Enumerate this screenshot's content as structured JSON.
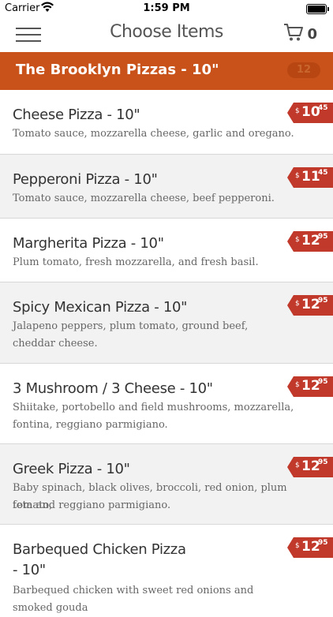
{
  "status_bar": {
    "carrier": "Carrier",
    "time": "1:59 PM"
  },
  "nav": {
    "title": "Choose Items",
    "cart_count": "0"
  },
  "section": {
    "title": "The Brooklyn Pizzas - 10\"",
    "count": "12"
  },
  "items": [
    {
      "name": "Cheese Pizza - 10\"",
      "desc_lines": [
        "Tomato sauce, mozzarella cheese, garlic and oregano."
      ],
      "price": {
        "currency": "$",
        "whole": "10",
        "cents": "45"
      }
    },
    {
      "name": "Pepperoni Pizza - 10\"",
      "desc_lines": [
        "Tomato sauce, mozzarella cheese, beef pepperoni."
      ],
      "price": {
        "currency": "$",
        "whole": "11",
        "cents": "45"
      }
    },
    {
      "name": "Margherita Pizza - 10\"",
      "desc_lines": [
        "Plum tomato, fresh mozzarella, and fresh basil."
      ],
      "price": {
        "currency": "$",
        "whole": "12",
        "cents": "95"
      }
    },
    {
      "name": "Spicy Mexican Pizza - 10\"",
      "desc_lines": [
        "Jalapeno peppers, plum tomato, ground beef,",
        "cheddar cheese."
      ],
      "price": {
        "currency": "$",
        "whole": "12",
        "cents": "95"
      }
    },
    {
      "name": "3 Mushroom / 3 Cheese - 10\"",
      "desc_lines": [
        "Shiitake, portobello and field mushrooms, mozzarella,",
        "fontina, reggiano parmigiano."
      ],
      "price": {
        "currency": "$",
        "whole": "12",
        "cents": "95"
      }
    },
    {
      "name": "Greek Pizza - 10\"",
      "desc_lines": [
        "Baby spinach, black olives, broccoli, red onion, plum tomato,",
        "feta and reggiano parmigiano."
      ],
      "price": {
        "currency": "$",
        "whole": "12",
        "cents": "95"
      }
    },
    {
      "name": "Barbequed Chicken Pizza",
      "name_line2": "- 10\"",
      "desc_lines": [
        "Barbequed chicken with sweet red onions and smoked gouda"
      ],
      "price": {
        "currency": "$",
        "whole": "12",
        "cents": "95"
      }
    }
  ]
}
